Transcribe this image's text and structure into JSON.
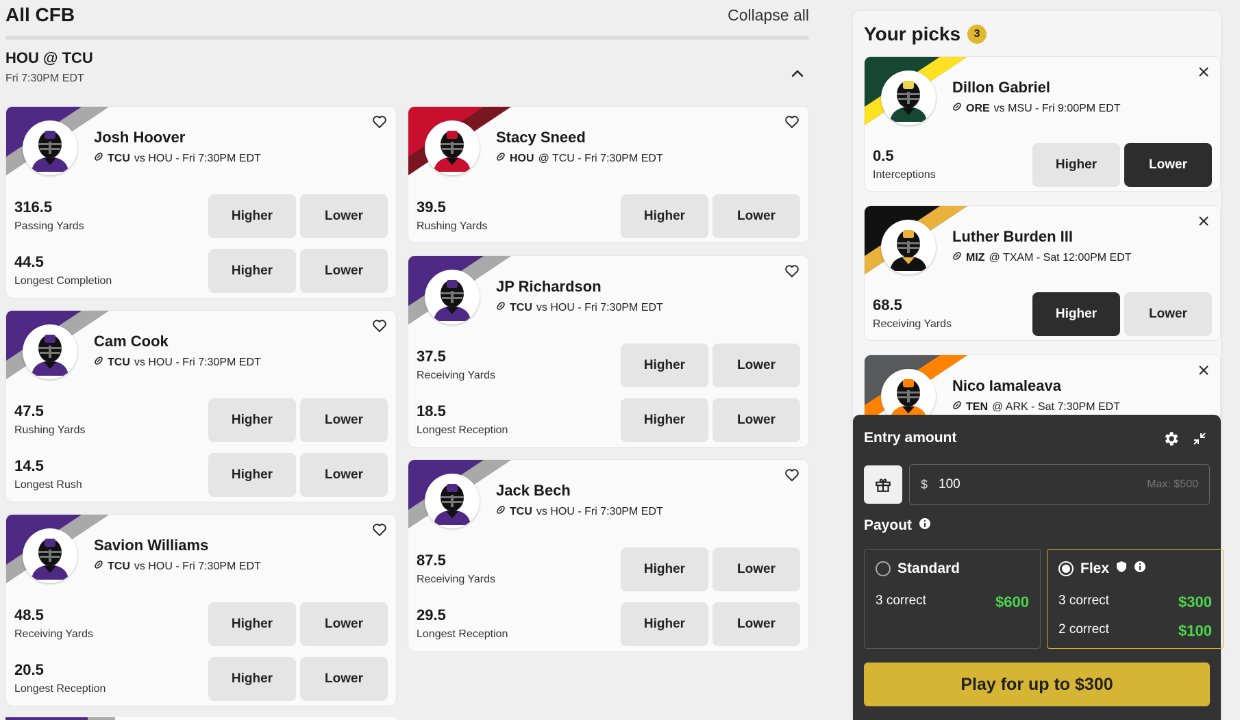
{
  "header": {
    "title": "All CFB",
    "collapse_label": "Collapse all"
  },
  "game": {
    "title": "HOU @ TCU",
    "time": "Fri 7:30PM EDT"
  },
  "buttons": {
    "higher": "Higher",
    "lower": "Lower"
  },
  "colors": {
    "tcu_purple": "#4e2a84",
    "hou_red": "#c8102e",
    "accent_gold": "#d6b534",
    "payout_green": "#4cd64c",
    "dark_selected": "#2d2d2d"
  },
  "players": [
    {
      "name": "Josh Hoover",
      "team": "TCU",
      "matchup_rest": "vs HOU - Fri 7:30PM EDT",
      "props": [
        {
          "value": "316.5",
          "stat": "Passing Yards"
        },
        {
          "value": "44.5",
          "stat": "Longest Completion"
        }
      ]
    },
    {
      "name": "Cam Cook",
      "team": "TCU",
      "matchup_rest": "vs HOU - Fri 7:30PM EDT",
      "props": [
        {
          "value": "47.5",
          "stat": "Rushing Yards"
        },
        {
          "value": "14.5",
          "stat": "Longest Rush"
        }
      ]
    },
    {
      "name": "Savion Williams",
      "team": "TCU",
      "matchup_rest": "vs HOU - Fri 7:30PM EDT",
      "props": [
        {
          "value": "48.5",
          "stat": "Receiving Yards"
        },
        {
          "value": "20.5",
          "stat": "Longest Reception"
        }
      ]
    },
    {
      "name": "Stacy Sneed",
      "team": "HOU",
      "matchup_rest": "@ TCU - Fri 7:30PM EDT",
      "props": [
        {
          "value": "39.5",
          "stat": "Rushing Yards"
        }
      ]
    },
    {
      "name": "JP Richardson",
      "team": "TCU",
      "matchup_rest": "vs HOU - Fri 7:30PM EDT",
      "props": [
        {
          "value": "37.5",
          "stat": "Receiving Yards"
        },
        {
          "value": "18.5",
          "stat": "Longest Reception"
        }
      ]
    },
    {
      "name": "Jack Bech",
      "team": "TCU",
      "matchup_rest": "vs HOU - Fri 7:30PM EDT",
      "props": [
        {
          "value": "87.5",
          "stat": "Receiving Yards"
        },
        {
          "value": "29.5",
          "stat": "Longest Reception"
        }
      ]
    }
  ],
  "picks": {
    "title": "Your picks",
    "count": "3",
    "items": [
      {
        "name": "Dillon Gabriel",
        "team": "ORE",
        "matchup_rest": "vs MSU - Fri 9:00PM EDT",
        "value": "0.5",
        "stat": "Interceptions",
        "selected": "lower"
      },
      {
        "name": "Luther Burden III",
        "team": "MIZ",
        "matchup_rest": "@ TXAM - Sat 12:00PM EDT",
        "value": "68.5",
        "stat": "Receiving Yards",
        "selected": "higher"
      },
      {
        "name": "Nico Iamaleava",
        "team": "TEN",
        "matchup_rest": "@ ARK - Sat 7:30PM EDT"
      }
    ]
  },
  "entry": {
    "title": "Entry amount",
    "currency": "$",
    "amount": "100",
    "max": "Max: $500",
    "payout_title": "Payout",
    "standard": {
      "label": "Standard",
      "rows": [
        {
          "label": "3 correct",
          "amount": "$600"
        }
      ]
    },
    "flex": {
      "label": "Flex",
      "rows": [
        {
          "label": "3 correct",
          "amount": "$300"
        },
        {
          "label": "2 correct",
          "amount": "$100"
        }
      ]
    },
    "play_label": "Play for up to $300"
  }
}
